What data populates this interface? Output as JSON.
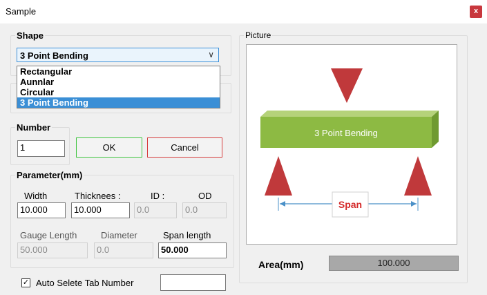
{
  "window": {
    "title": "Sample",
    "close_label": "x"
  },
  "shape": {
    "group_label": "Shape",
    "selected": "3 Point Bending",
    "options": [
      "Rectangular",
      "Aunnlar",
      "Circular",
      "3 Point Bending"
    ]
  },
  "number": {
    "group_label": "Number",
    "value": "1",
    "ok_label": "OK",
    "cancel_label": "Cancel"
  },
  "parameter": {
    "group_label": "Parameter(mm)",
    "width": {
      "label": "Width",
      "value": "10.000"
    },
    "thickness": {
      "label": "Thicknees :",
      "value": "10.000"
    },
    "id": {
      "label": "ID :",
      "value": "0.0"
    },
    "od": {
      "label": "OD",
      "value": "0.0"
    },
    "gauge_length": {
      "label": "Gauge Length",
      "value": "50.000"
    },
    "diameter": {
      "label": "Diameter",
      "value": "0.0"
    },
    "span_length": {
      "label": "Span length",
      "value": "50.000"
    }
  },
  "auto_tab": {
    "label": "Auto Selete Tab Number",
    "checked": true,
    "check_mark": "✓",
    "value": ""
  },
  "picture": {
    "group_label": "Picture",
    "beam_label": "3 Point Bending",
    "span_label": "Span"
  },
  "area": {
    "label": "Area(mm)",
    "value": "100.000"
  },
  "colors": {
    "beam": "#8dba43",
    "arrow": "#c0393b",
    "span_text": "#d42a2a",
    "accent_ok": "#3bc43b",
    "accent_cancel": "#d63a3a",
    "select_border": "#3c8fd8"
  }
}
